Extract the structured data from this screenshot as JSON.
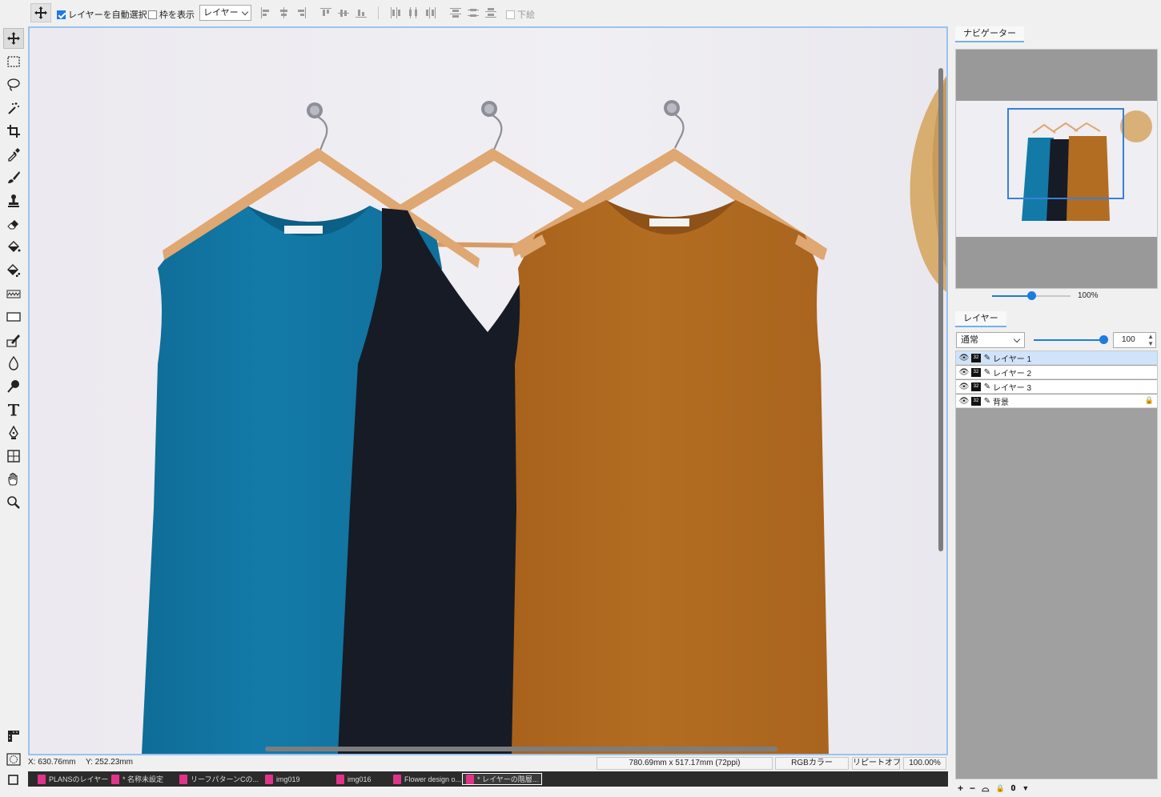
{
  "options_bar": {
    "auto_select_label": "レイヤーを自動選択",
    "auto_select_checked": true,
    "show_bounds_label": "枠を表示",
    "show_bounds_checked": false,
    "select_target": "レイヤー",
    "sample_label": "下絵",
    "sample_checked": false
  },
  "tools": [
    {
      "name": "move-tool",
      "icon": "move-icon",
      "active": true
    },
    {
      "name": "rect-select-tool",
      "icon": "rect-select-icon"
    },
    {
      "name": "lasso-tool",
      "icon": "lasso-icon"
    },
    {
      "name": "magic-wand-tool",
      "icon": "magic-wand-icon"
    },
    {
      "name": "crop-tool",
      "icon": "crop-icon"
    },
    {
      "name": "eyedropper-tool",
      "icon": "eyedropper-icon"
    },
    {
      "name": "brush-tool",
      "icon": "brush-icon"
    },
    {
      "name": "stamp-tool",
      "icon": "stamp-icon"
    },
    {
      "name": "eraser-tool",
      "icon": "eraser-icon"
    },
    {
      "name": "fill-tool",
      "icon": "bucket-icon"
    },
    {
      "name": "pattern-fill-tool",
      "icon": "pattern-bucket-icon"
    },
    {
      "name": "gradient-tool",
      "icon": "gradient-icon"
    },
    {
      "name": "shape-tool",
      "icon": "rectangle-icon"
    },
    {
      "name": "retouch-tool",
      "icon": "retouch-icon"
    },
    {
      "name": "blur-tool",
      "icon": "drop-icon"
    },
    {
      "name": "smudge-tool",
      "icon": "smudge-icon"
    },
    {
      "name": "text-tool",
      "icon": "text-icon"
    },
    {
      "name": "pen-tool",
      "icon": "pen-nib-icon"
    },
    {
      "name": "transform-tool",
      "icon": "transform-icon"
    },
    {
      "name": "hand-tool",
      "icon": "hand-icon"
    },
    {
      "name": "zoom-tool",
      "icon": "magnifier-icon"
    }
  ],
  "status": {
    "x": "X:  630.76mm",
    "y": "Y:  252.23mm",
    "doc_size": "780.69mm x 517.17mm (72ppi)",
    "color_mode": "RGBカラー",
    "repeat": "リピートオフ",
    "zoom": "100.00%"
  },
  "doc_tabs": [
    {
      "label": "PLANSのレイヤー",
      "selected": false
    },
    {
      "label": "* 名称未設定",
      "selected": false
    },
    {
      "label": "リーフパターンCの...",
      "selected": false
    },
    {
      "label": "img019",
      "selected": false
    },
    {
      "label": "img016",
      "selected": false
    },
    {
      "label": "Flower design o...",
      "selected": false
    },
    {
      "label": "* レイヤーの階層...",
      "selected": true
    }
  ],
  "navigator": {
    "tab_label": "ナビゲーター",
    "zoom_label": "100%",
    "zoom_fraction": 0.5
  },
  "layers_panel": {
    "tab_label": "レイヤー",
    "blend_mode": "通常",
    "opacity": "100",
    "opacity_fraction": 1.0,
    "layers": [
      {
        "name": "レイヤー 1",
        "selected": true,
        "locked": false,
        "bit": "32"
      },
      {
        "name": "レイヤー 2",
        "selected": false,
        "locked": false,
        "bit": "32"
      },
      {
        "name": "レイヤー 3",
        "selected": false,
        "locked": false,
        "bit": "32"
      },
      {
        "name": "背景",
        "selected": false,
        "locked": true,
        "bit": "32"
      }
    ]
  },
  "colors": {
    "accent": "#1e7be0",
    "canvas_border": "#9cc2ee",
    "teal_shirt": "#137aa8",
    "navy_shirt": "#171b26",
    "brown_shirt": "#b36d22",
    "hanger_wood": "#dfa772"
  }
}
